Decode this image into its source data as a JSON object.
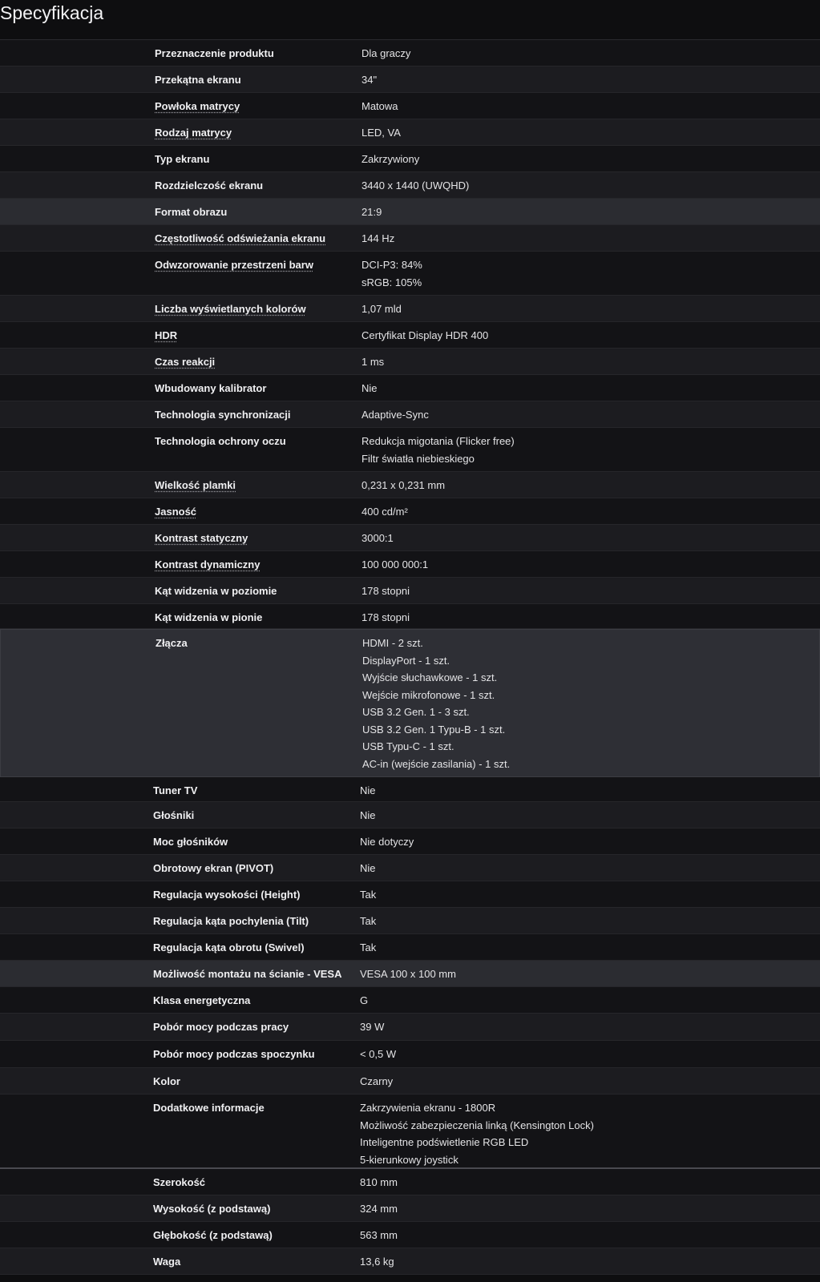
{
  "title": "Specyfikacja",
  "rows": [
    {
      "label": "Przeznaczenie produktu",
      "values": [
        "Dla graczy"
      ],
      "h": 33,
      "bg": "a",
      "u": false,
      "s": 1
    },
    {
      "label": "Przekątna ekranu",
      "values": [
        "34\""
      ],
      "h": 33,
      "bg": "b",
      "u": false,
      "s": 1
    },
    {
      "label": "Powłoka matrycy",
      "values": [
        "Matowa"
      ],
      "h": 33,
      "bg": "a",
      "u": true,
      "s": 1
    },
    {
      "label": "Rodzaj matrycy",
      "values": [
        "LED, VA"
      ],
      "h": 33,
      "bg": "b",
      "u": true,
      "s": 1
    },
    {
      "label": "Typ ekranu",
      "values": [
        "Zakrzywiony"
      ],
      "h": 33,
      "bg": "a",
      "u": false,
      "s": 1
    },
    {
      "label": "Rozdzielczość ekranu",
      "values": [
        "3440 x 1440 (UWQHD)"
      ],
      "h": 33,
      "bg": "b",
      "u": false,
      "s": 1
    },
    {
      "label": "Format obrazu",
      "values": [
        "21:9"
      ],
      "h": 33,
      "bg": "h",
      "u": false,
      "s": 1
    },
    {
      "label": "Częstotliwość odświeżania ekranu",
      "values": [
        "144 Hz"
      ],
      "h": 33,
      "bg": "b",
      "u": true,
      "s": 1
    },
    {
      "label": "Odwzorowanie przestrzeni barw",
      "values": [
        "DCI-P3: 84%",
        "sRGB: 105%"
      ],
      "h": 55,
      "bg": "a",
      "u": true,
      "s": 1
    },
    {
      "label": "Liczba wyświetlanych kolorów",
      "values": [
        "1,07 mld"
      ],
      "h": 33,
      "bg": "b",
      "u": true,
      "s": 1
    },
    {
      "label": "HDR",
      "values": [
        "Certyfikat Display HDR 400"
      ],
      "h": 33,
      "bg": "a",
      "u": true,
      "s": 1
    },
    {
      "label": "Czas reakcji",
      "values": [
        "1 ms"
      ],
      "h": 33,
      "bg": "b",
      "u": true,
      "s": 1
    },
    {
      "label": "Wbudowany kalibrator",
      "values": [
        "Nie"
      ],
      "h": 33,
      "bg": "a",
      "u": false,
      "s": 1
    },
    {
      "label": "Technologia synchronizacji",
      "values": [
        "Adaptive-Sync"
      ],
      "h": 33,
      "bg": "b",
      "u": false,
      "s": 1
    },
    {
      "label": "Technologia ochrony oczu",
      "values": [
        "Redukcja migotania (Flicker free)",
        "Filtr światła niebieskiego"
      ],
      "h": 55,
      "bg": "a",
      "u": false,
      "s": 1
    },
    {
      "label": "Wielkość plamki",
      "values": [
        "0,231 x 0,231 mm"
      ],
      "h": 33,
      "bg": "b",
      "u": true,
      "s": 1
    },
    {
      "label": "Jasność",
      "values": [
        "400 cd/m²"
      ],
      "h": 33,
      "bg": "a",
      "u": true,
      "s": 1
    },
    {
      "label": "Kontrast statyczny",
      "values": [
        "3000:1"
      ],
      "h": 33,
      "bg": "b",
      "u": true,
      "s": 1
    },
    {
      "label": "Kontrast dynamiczny",
      "values": [
        "100 000 000:1"
      ],
      "h": 33,
      "bg": "a",
      "u": true,
      "s": 1
    },
    {
      "label": "Kąt widzenia w poziomie",
      "values": [
        "178 stopni"
      ],
      "h": 33,
      "bg": "b",
      "u": false,
      "s": 1
    },
    {
      "label": "Kąt widzenia w pionie",
      "values": [
        "178 stopni"
      ],
      "h": 31,
      "bg": "a",
      "u": false,
      "s": 1
    },
    {
      "label": "Złącza",
      "values": [
        "HDMI - 2 szt.",
        "DisplayPort - 1 szt.",
        "Wyjście słuchawkowe - 1 szt.",
        "Wejście mikrofonowe - 1 szt.",
        "USB 3.2 Gen. 1 - 3 szt.",
        "USB 3.2 Gen. 1 Typu-B - 1 szt.",
        "USB Typu-C - 1 szt.",
        "AC-in (wejście zasilania) - 1 szt."
      ],
      "h": 185,
      "bg": "box",
      "u": false,
      "s": 1
    },
    {
      "label": "Tuner TV",
      "values": [
        "Nie"
      ],
      "h": 31,
      "bg": "a",
      "u": false,
      "s": 2
    },
    {
      "label": "Głośniki",
      "values": [
        "Nie"
      ],
      "h": 33,
      "bg": "b",
      "u": false,
      "s": 2
    },
    {
      "label": "Moc głośników",
      "values": [
        "Nie dotyczy"
      ],
      "h": 33,
      "bg": "a",
      "u": false,
      "s": 2
    },
    {
      "label": "Obrotowy ekran (PIVOT)",
      "values": [
        "Nie"
      ],
      "h": 33,
      "bg": "b",
      "u": false,
      "s": 2
    },
    {
      "label": "Regulacja wysokości (Height)",
      "values": [
        "Tak"
      ],
      "h": 33,
      "bg": "a",
      "u": false,
      "s": 2
    },
    {
      "label": "Regulacja kąta pochylenia (Tilt)",
      "values": [
        "Tak"
      ],
      "h": 33,
      "bg": "b",
      "u": false,
      "s": 2
    },
    {
      "label": "Regulacja kąta obrotu (Swivel)",
      "values": [
        "Tak"
      ],
      "h": 33,
      "bg": "a",
      "u": false,
      "s": 2
    },
    {
      "label": "Możliwość montażu na ścianie - VESA",
      "values": [
        "VESA 100 x 100 mm"
      ],
      "h": 33,
      "bg": "h",
      "u": false,
      "s": 2
    },
    {
      "label": "Klasa energetyczna",
      "values": [
        "G"
      ],
      "h": 33,
      "bg": "a",
      "u": false,
      "s": 2
    },
    {
      "label": "Pobór mocy podczas pracy",
      "values": [
        "39 W"
      ],
      "h": 34,
      "bg": "b",
      "u": false,
      "s": 2
    },
    {
      "label": "Pobór mocy podczas spoczynku",
      "values": [
        "< 0,5 W"
      ],
      "h": 34,
      "bg": "a",
      "u": false,
      "s": 2
    },
    {
      "label": "Kolor",
      "values": [
        "Czarny"
      ],
      "h": 33,
      "bg": "b",
      "u": false,
      "s": 2
    },
    {
      "label": "Dodatkowe informacje",
      "values": [
        "Zakrzywienia ekranu - 1800R",
        "Możliwość zabezpieczenia linką (Kensington Lock)",
        "Inteligentne podświetlenie RGB LED",
        "5-kierunkowy joystick"
      ],
      "h": 93,
      "bg": "a",
      "u": false,
      "s": 2,
      "sep": true
    },
    {
      "label": "Szerokość",
      "values": [
        "810 mm"
      ],
      "h": 33,
      "bg": "a",
      "u": false,
      "s": 2
    },
    {
      "label": "Wysokość (z podstawą)",
      "values": [
        "324 mm"
      ],
      "h": 33,
      "bg": "b",
      "u": false,
      "s": 2
    },
    {
      "label": "Głębokość (z podstawą)",
      "values": [
        "563 mm"
      ],
      "h": 33,
      "bg": "a",
      "u": false,
      "s": 2
    },
    {
      "label": "Waga",
      "values": [
        "13,6 kg"
      ],
      "h": 33,
      "bg": "b",
      "u": false,
      "s": 2
    }
  ]
}
